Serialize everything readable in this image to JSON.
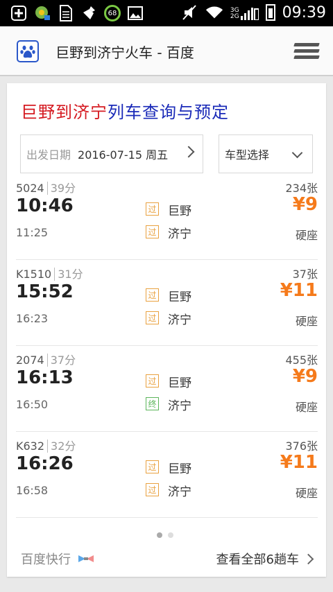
{
  "status": {
    "time": "09:39",
    "ring": "68",
    "net_top": "3G",
    "net_bottom": "2G"
  },
  "appbar": {
    "title": "巨野到济宁火车 - 百度"
  },
  "headline": {
    "part1": "巨野到济宁",
    "part2": "列车查询与预定"
  },
  "date": {
    "label": "出发日期",
    "value": "2016-07-15 周五"
  },
  "type": {
    "label": "车型选择"
  },
  "trains": [
    {
      "code": "5024",
      "dur": "39分",
      "dep": "10:46",
      "arr": "11:25",
      "from_tag": "过",
      "from": "巨野",
      "to_tag": "过",
      "to": "济宁",
      "count": "234张",
      "price": "¥9",
      "seat": "硬座"
    },
    {
      "code": "K1510",
      "dur": "31分",
      "dep": "15:52",
      "arr": "16:23",
      "from_tag": "过",
      "from": "巨野",
      "to_tag": "过",
      "to": "济宁",
      "count": "37张",
      "price": "¥11",
      "seat": "硬座"
    },
    {
      "code": "2074",
      "dur": "37分",
      "dep": "16:13",
      "arr": "16:50",
      "from_tag": "过",
      "from": "巨野",
      "to_tag": "终",
      "to": "济宁",
      "count": "455张",
      "price": "¥9",
      "seat": "硬座"
    },
    {
      "code": "K632",
      "dur": "32分",
      "dep": "16:26",
      "arr": "16:58",
      "from_tag": "过",
      "from": "巨野",
      "to_tag": "过",
      "to": "济宁",
      "count": "376张",
      "price": "¥11",
      "seat": "硬座"
    }
  ],
  "footer": {
    "left": "百度快行",
    "right": "查看全部6趟车"
  }
}
